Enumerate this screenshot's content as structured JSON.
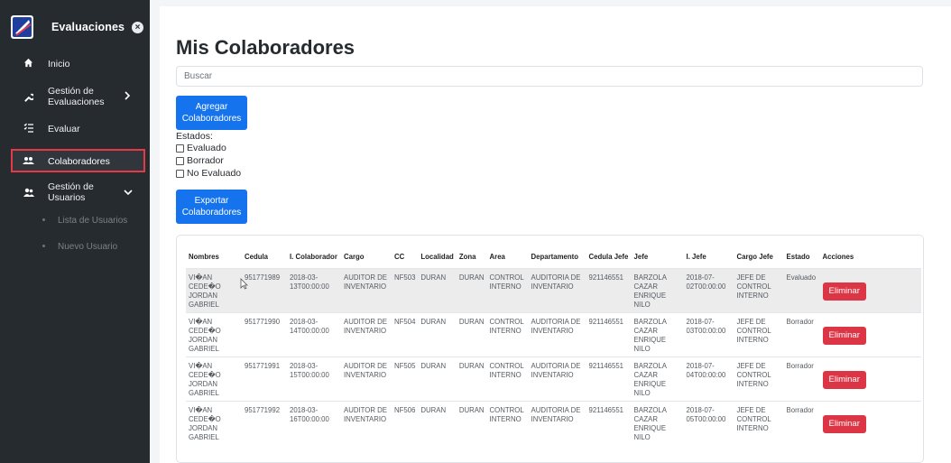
{
  "sidebar": {
    "title": "Evaluaciones",
    "close_glyph": "×",
    "items": [
      {
        "label": "Inicio",
        "icon": "home-icon"
      },
      {
        "label_line1": "Gestión de",
        "label_line2": "Evaluaciones",
        "icon": "wrench-icon"
      },
      {
        "label": "Evaluar",
        "icon": "list-check-icon"
      },
      {
        "label": "Colaboradores",
        "icon": "users-icon"
      },
      {
        "label_line1": "Gestión de",
        "label_line2": "Usuarios",
        "icon": "user-group-icon"
      }
    ],
    "subitems": [
      "Lista de Usuarios",
      "Nuevo Usuario"
    ]
  },
  "main": {
    "title": "Mis Colaboradores",
    "search_placeholder": "Buscar",
    "add_button_line1": "Agregar",
    "add_button_line2": "Colaboradores",
    "estados_label": "Estados:",
    "filters": [
      "Evaluado",
      "Borrador",
      "No Evaluado"
    ],
    "export_button_line1": "Exportar",
    "export_button_line2": "Colaboradores"
  },
  "table": {
    "headers": [
      "Nombres",
      "Cedula",
      "I. Colaborador",
      "Cargo",
      "CC",
      "Localidad",
      "Zona",
      "Area",
      "Departamento",
      "Cedula Jefe",
      "Jefe",
      "I. Jefe",
      "Cargo Jefe",
      "Estado",
      "Acciones"
    ],
    "rows": [
      {
        "n1": "VI�AN",
        "n2": "CEDE�O",
        "n3": "JORDAN",
        "n4": "GABRIEL",
        "cedula": "951771989",
        "ic1": "2018-03-",
        "ic2": "13T00:00:00",
        "cargo1": "AUDITOR DE",
        "cargo2": "INVENTARIO",
        "cc": "NF503",
        "localidad": "DURAN",
        "zona": "DURAN",
        "area1": "CONTROL",
        "area2": "INTERNO",
        "dep1": "AUDITORIA DE",
        "dep2": "INVENTARIO",
        "cedula_jefe": "921146551",
        "jefe1": "BARZOLA",
        "jefe2": "CAZAR",
        "jefe3": "ENRIQUE NILO",
        "ij1": "2018-07-",
        "ij2": "02T00:00:00",
        "cj1": "JEFE DE",
        "cj2": "CONTROL",
        "cj3": "INTERNO",
        "estado": "Evaluado",
        "accion": "Eliminar"
      },
      {
        "n1": "VI�AN",
        "n2": "CEDE�O",
        "n3": "JORDAN",
        "n4": "GABRIEL",
        "cedula": "951771990",
        "ic1": "2018-03-",
        "ic2": "14T00:00:00",
        "cargo1": "AUDITOR DE",
        "cargo2": "INVENTARIO",
        "cc": "NF504",
        "localidad": "DURAN",
        "zona": "DURAN",
        "area1": "CONTROL",
        "area2": "INTERNO",
        "dep1": "AUDITORIA DE",
        "dep2": "INVENTARIO",
        "cedula_jefe": "921146551",
        "jefe1": "BARZOLA",
        "jefe2": "CAZAR",
        "jefe3": "ENRIQUE NILO",
        "ij1": "2018-07-",
        "ij2": "03T00:00:00",
        "cj1": "JEFE DE",
        "cj2": "CONTROL",
        "cj3": "INTERNO",
        "estado": "Borrador",
        "accion": "Eliminar"
      },
      {
        "n1": "VI�AN",
        "n2": "CEDE�O",
        "n3": "JORDAN",
        "n4": "GABRIEL",
        "cedula": "951771991",
        "ic1": "2018-03-",
        "ic2": "15T00:00:00",
        "cargo1": "AUDITOR DE",
        "cargo2": "INVENTARIO",
        "cc": "NF505",
        "localidad": "DURAN",
        "zona": "DURAN",
        "area1": "CONTROL",
        "area2": "INTERNO",
        "dep1": "AUDITORIA DE",
        "dep2": "INVENTARIO",
        "cedula_jefe": "921146551",
        "jefe1": "BARZOLA",
        "jefe2": "CAZAR",
        "jefe3": "ENRIQUE NILO",
        "ij1": "2018-07-",
        "ij2": "04T00:00:00",
        "cj1": "JEFE DE",
        "cj2": "CONTROL",
        "cj3": "INTERNO",
        "estado": "Borrador",
        "accion": "Eliminar"
      },
      {
        "n1": "VI�AN",
        "n2": "CEDE�O",
        "n3": "JORDAN",
        "n4": "GABRIEL",
        "cedula": "951771992",
        "ic1": "2018-03-",
        "ic2": "16T00:00:00",
        "cargo1": "AUDITOR DE",
        "cargo2": "INVENTARIO",
        "cc": "NF506",
        "localidad": "DURAN",
        "zona": "DURAN",
        "area1": "CONTROL",
        "area2": "INTERNO",
        "dep1": "AUDITORIA DE",
        "dep2": "INVENTARIO",
        "cedula_jefe": "921146551",
        "jefe1": "BARZOLA",
        "jefe2": "CAZAR",
        "jefe3": "ENRIQUE NILO",
        "ij1": "2018-07-",
        "ij2": "05T00:00:00",
        "cj1": "JEFE DE",
        "cj2": "CONTROL",
        "cj3": "INTERNO",
        "estado": "Borrador",
        "accion": "Eliminar"
      }
    ]
  },
  "colors": {
    "sidebar_bg": "#262b30",
    "primary": "#1573ee",
    "danger": "#dc3545",
    "highlight_border": "#e63946"
  }
}
